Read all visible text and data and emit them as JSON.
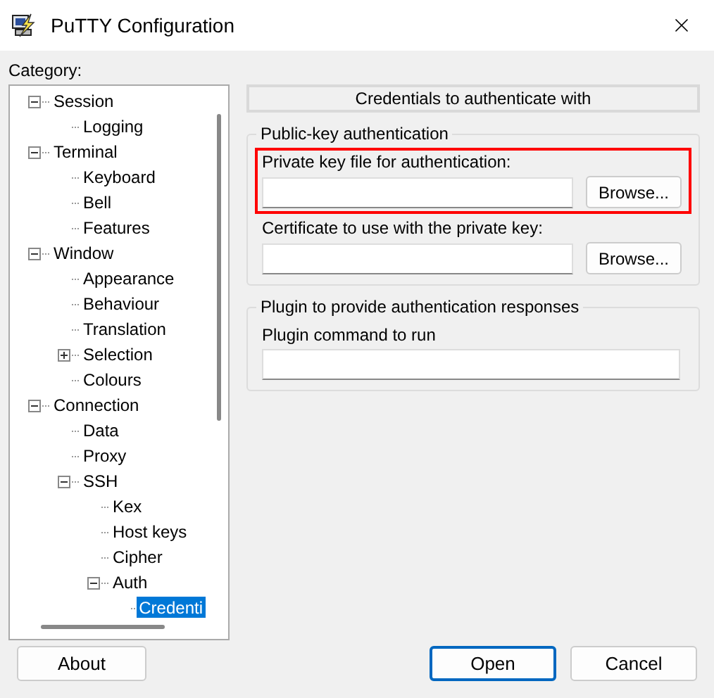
{
  "window": {
    "title": "PuTTY Configuration"
  },
  "category_label": "Category:",
  "tree": [
    {
      "label": "Session",
      "expanded": true,
      "selected": false,
      "children": [
        {
          "label": "Logging",
          "selected": false
        }
      ]
    },
    {
      "label": "Terminal",
      "expanded": true,
      "selected": false,
      "children": [
        {
          "label": "Keyboard",
          "selected": false
        },
        {
          "label": "Bell",
          "selected": false
        },
        {
          "label": "Features",
          "selected": false
        }
      ]
    },
    {
      "label": "Window",
      "expanded": true,
      "selected": false,
      "children": [
        {
          "label": "Appearance",
          "selected": false
        },
        {
          "label": "Behaviour",
          "selected": false
        },
        {
          "label": "Translation",
          "selected": false
        },
        {
          "label": "Selection",
          "expanded": false,
          "selected": false
        },
        {
          "label": "Colours",
          "selected": false
        }
      ]
    },
    {
      "label": "Connection",
      "expanded": true,
      "selected": false,
      "children": [
        {
          "label": "Data",
          "selected": false
        },
        {
          "label": "Proxy",
          "selected": false
        },
        {
          "label": "SSH",
          "expanded": true,
          "selected": false,
          "children": [
            {
              "label": "Kex",
              "selected": false
            },
            {
              "label": "Host keys",
              "selected": false
            },
            {
              "label": "Cipher",
              "selected": false
            },
            {
              "label": "Auth",
              "expanded": true,
              "selected": false,
              "children": [
                {
                  "label": "Credenti",
                  "selected": true
                }
              ]
            }
          ]
        }
      ]
    }
  ],
  "panel": {
    "header": "Credentials to authenticate with",
    "groups": [
      {
        "title": "Public-key authentication",
        "fields": [
          {
            "label": "Private key file for authentication:",
            "button": "Browse...",
            "highlighted": true
          },
          {
            "label": "Certificate to use with the private key:",
            "button": "Browse...",
            "highlighted": false
          }
        ]
      },
      {
        "title": "Plugin to provide authentication responses",
        "fields": [
          {
            "label": "Plugin command to run",
            "highlighted": false
          }
        ]
      }
    ]
  },
  "buttons": [
    {
      "label": "About",
      "default": false
    },
    {
      "label": "Open",
      "default": true
    },
    {
      "label": "Cancel",
      "default": false
    }
  ]
}
